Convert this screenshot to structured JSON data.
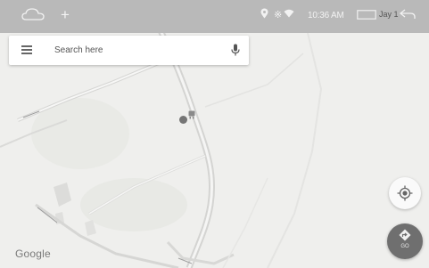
{
  "status_bar": {
    "time": "10:36 AM",
    "user_label": "Jay 1",
    "icons": [
      "cloud-icon",
      "plus-icon",
      "location-icon",
      "bluetooth-icon",
      "wifi-icon",
      "window-icon",
      "back-icon"
    ]
  },
  "search": {
    "placeholder": "Search here",
    "menu_icon": "menu-icon",
    "mic_icon": "mic-icon"
  },
  "map": {
    "attribution": "Google"
  },
  "buttons": {
    "locate_icon": "my-location-icon",
    "go_label": "GO",
    "go_icon": "directions-icon"
  },
  "colors": {
    "status_bar": "#b9b9b9",
    "map_background": "#efefed",
    "road": "#d2d2d0",
    "go_button": "#6f6f6f"
  }
}
